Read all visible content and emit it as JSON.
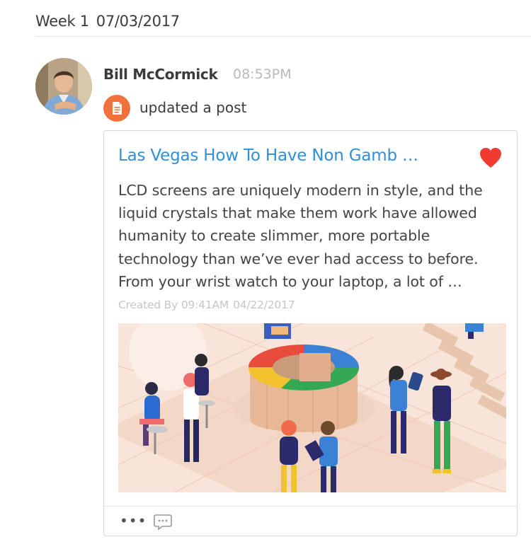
{
  "header": {
    "week": "Week 1",
    "date": "07/03/2017"
  },
  "activity": {
    "author": "Bill McCormick",
    "time": "08:53PM",
    "action": "updated a post",
    "badge_icon": "document-icon",
    "badge_color": "#f2713b"
  },
  "post": {
    "title": "Las Vegas How To Have Non Gamb …",
    "title_color": "#2f8fd8",
    "liked": true,
    "heart_color": "#f23b30",
    "body": "LCD screens are uniquely modern in style, and the liquid crystals that make them work have allowed humanity to create slimmer, more portable technology than we’ve ever had access to before. From your wrist watch to your laptop, a lot of  …",
    "meta": {
      "label": "Created By",
      "time": "09:41AM",
      "date": "04/22/2017"
    }
  },
  "footer": {
    "more": "•••",
    "more_icon": "more-icon",
    "comment_icon": "comment-icon"
  }
}
